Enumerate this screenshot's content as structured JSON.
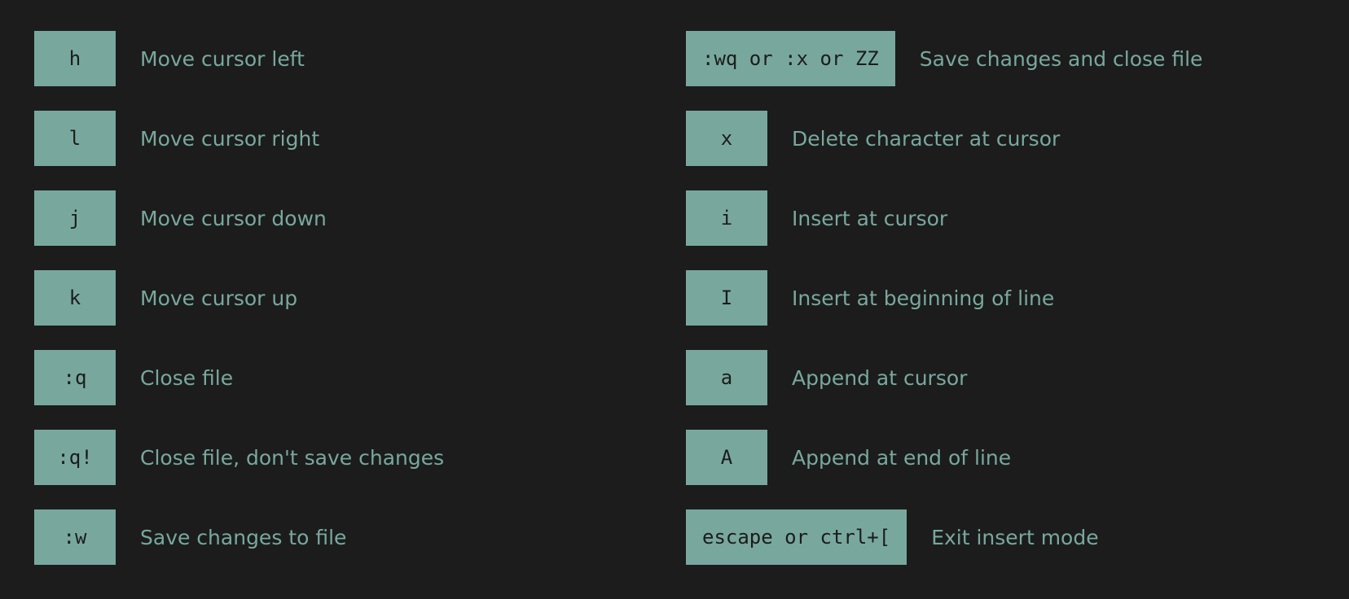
{
  "colors": {
    "background": "#1c1c1c",
    "accent": "#78a89d",
    "key_text": "#1c1c1c"
  },
  "left": [
    {
      "key": "h",
      "desc": "Move cursor left"
    },
    {
      "key": "l",
      "desc": "Move cursor right"
    },
    {
      "key": "j",
      "desc": "Move cursor down"
    },
    {
      "key": "k",
      "desc": "Move cursor up"
    },
    {
      "key": ":q",
      "desc": "Close file"
    },
    {
      "key": ":q!",
      "desc": "Close file, don't save changes"
    },
    {
      "key": ":w",
      "desc": "Save changes to file"
    }
  ],
  "right": [
    {
      "key": ":wq or :x or ZZ",
      "desc": "Save changes and close file"
    },
    {
      "key": "x",
      "desc": "Delete character at cursor"
    },
    {
      "key": "i",
      "desc": "Insert at cursor"
    },
    {
      "key": "I",
      "desc": "Insert at beginning of line"
    },
    {
      "key": "a",
      "desc": "Append at cursor"
    },
    {
      "key": "A",
      "desc": "Append at end of line"
    },
    {
      "key": "escape or ctrl+[",
      "desc": "Exit insert mode"
    }
  ]
}
